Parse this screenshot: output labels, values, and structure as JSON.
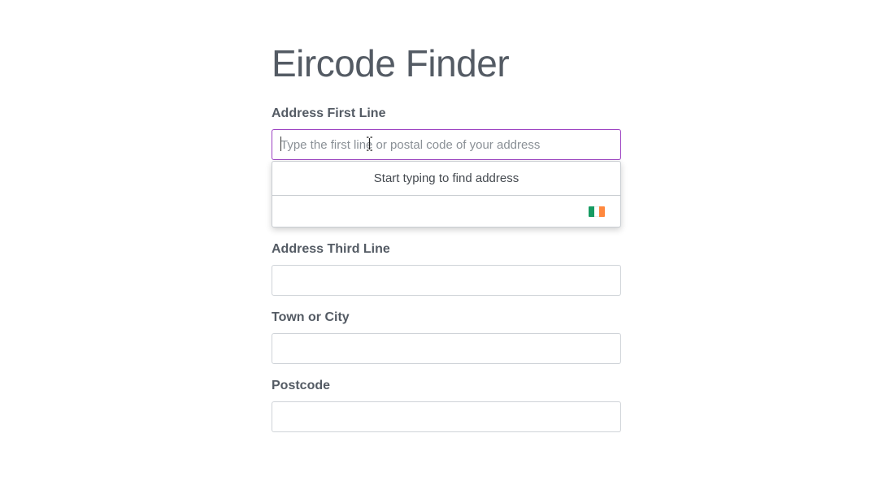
{
  "page": {
    "title": "Eircode Finder"
  },
  "fields": {
    "address_first_line": {
      "label": "Address First Line",
      "placeholder": "Type the first line or postal code of your address",
      "value": ""
    },
    "address_third_line": {
      "label": "Address Third Line",
      "value": ""
    },
    "town_or_city": {
      "label": "Town or City",
      "value": ""
    },
    "postcode": {
      "label": "Postcode",
      "value": ""
    }
  },
  "dropdown": {
    "message": "Start typing to find address",
    "country_flag_icon": "ireland-flag-icon"
  },
  "colors": {
    "focus_border": "#9b3fc1",
    "text": "#545b64",
    "flag_green": "#169b62",
    "flag_white": "#ffffff",
    "flag_orange": "#ff883e"
  }
}
